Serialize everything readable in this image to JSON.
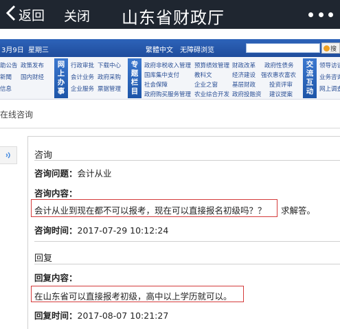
{
  "topbar": {
    "back_label": "返回",
    "close_label": "关闭",
    "title": "山东省财政厅"
  },
  "infobar": {
    "date": "3月9日",
    "weekday": "星期三",
    "lang": "繁體中文",
    "accessibility": "无障碍浏览",
    "search_button": "搜"
  },
  "nav": {
    "col1": [
      "助公告",
      "政策发布",
      "新聞",
      "国内财经",
      "信息"
    ],
    "cat1": "网上办事",
    "col2": [
      "行政审批",
      "下载中心",
      "会计业务",
      "政府采购",
      "企业服务",
      "票据管理"
    ],
    "cat2": "专题栏目",
    "col3": [
      "政府非税收入管理",
      "预算绩效管理",
      "国库集中支付",
      "教科文",
      "社会保障",
      "企业之窗",
      "政府购买服务管理",
      "农业综合开发"
    ],
    "col4": [
      "财政改革",
      "政府性债务",
      "经济建设",
      "强农惠农富农",
      "基层财政",
      "投资评审",
      "政府投融资",
      "建议提案"
    ],
    "cat3": "交流互动",
    "col5": [
      "领导访谈",
      "业务咨询",
      "网上调查"
    ]
  },
  "section_title": "在线咨询",
  "consult": {
    "heading": "咨询",
    "question_label": "咨询问题：",
    "question_value": "会计从业",
    "content_label": "咨询内容：",
    "content_value": "会计从业到现在都不可以报考，现在可以直接报名初级吗？？",
    "content_suffix": "求解答。",
    "time_label": "咨询时间：",
    "time_value": "2017-07-29 10:12:24"
  },
  "reply": {
    "heading": "回复",
    "content_label": "回复内容：",
    "content_value": "在山东省可以直接报考初级，高中以上学历就可以。",
    "time_label": "回复时间：",
    "time_value": "2017-08-07 10:21:27"
  },
  "colors": {
    "topbar": "#1f2630",
    "infobar": "#2d63b9",
    "highlight": "#d43a3a"
  }
}
